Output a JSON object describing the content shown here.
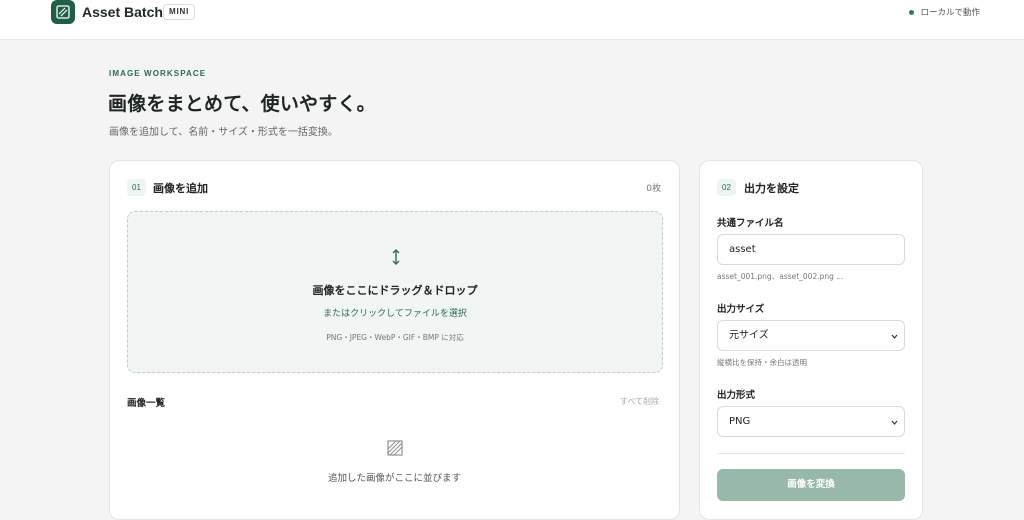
{
  "header": {
    "brand": "Asset Batch",
    "badge": "MINI",
    "status": "ローカルで動作",
    "status_color": "#2e7a59"
  },
  "hero": {
    "eyebrow": "IMAGE WORKSPACE",
    "title": "画像をまとめて、使いやすく。",
    "subtitle": "画像を追加して、名前・サイズ・形式を一括変換。"
  },
  "add_panel": {
    "step": "01",
    "title": "画像を追加",
    "count": "0枚",
    "dropzone": {
      "icon": "upload-arrow-icon",
      "title": "画像をここにドラッグ＆ドロップ",
      "link": "またはクリックしてファイルを選択",
      "formats": "PNG・JPEG・WebP・GIF・BMP に対応"
    },
    "list": {
      "title": "画像一覧",
      "clear_all": "すべて削除",
      "empty_icon": "image-placeholder-icon",
      "empty_text": "追加した画像がここに並びます"
    }
  },
  "output_panel": {
    "step": "02",
    "title": "出力を設定",
    "filename": {
      "label": "共通ファイル名",
      "value": "asset",
      "hint": "asset_001.png、asset_002.png ..."
    },
    "size": {
      "label": "出力サイズ",
      "selected": "元サイズ",
      "hint": "縦横比を保持・余白は透明"
    },
    "format": {
      "label": "出力形式",
      "selected": "PNG"
    },
    "convert_button": "画像を変換"
  },
  "colors": {
    "accent": "#1f5f46",
    "button_disabled": "#98b9aa",
    "page_bg": "#f3f4f3"
  }
}
